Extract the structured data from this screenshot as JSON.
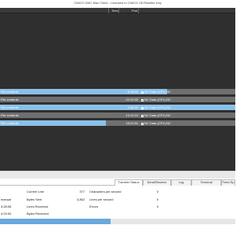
{
  "window": {
    "title": "CIMCO DNC-Max Client - Licensed to CIMCO V8 Reseller Key"
  },
  "queue": {
    "headers": [
      "Time",
      "Port"
    ],
    "rows": [
      {
        "label": "File contents",
        "time": "6:18:00",
        "source": "NC Data (CP1) NC",
        "progress": 0.71
      },
      {
        "label": "File contents",
        "time": "22:10:32",
        "source": "NC Data (CP1) NC",
        "progress": 0.0
      },
      {
        "label": "File contents",
        "time": "1:25:32",
        "source": "NC Data (CP1) NC",
        "progress": 1.0
      },
      {
        "label": "File contents",
        "time": "13:12:10",
        "source": "NC Data (CP1) NC",
        "progress": 0.0
      },
      {
        "label": "File contents",
        "time": "16:21:51",
        "source": "NC Data (CP1) NC",
        "progress": 0.45
      }
    ]
  },
  "tabs": [
    {
      "label": "Transfer Status",
      "active": true
    },
    {
      "label": "Send/Receive",
      "active": false
    },
    {
      "label": "Log",
      "active": false
    },
    {
      "label": "Terminal",
      "active": false
    },
    {
      "label": "Feed Sp",
      "active": false
    }
  ],
  "status": {
    "manual_label": "manual",
    "time1": "3:28:08",
    "time2": "4:23:53",
    "current_line_label": "Current Line",
    "current_line_value": "377",
    "bytes_sent_label": "Bytes Sent",
    "bytes_sent_value": "3,862",
    "lines_received_label": "Lines Received",
    "lines_received_value": "",
    "bytes_received_label": "Bytes Received",
    "bytes_received_value": "",
    "cps_label": "Characters per second",
    "cps_value": "0",
    "lps_label": "Lines per second",
    "lps_value": "0",
    "errors_label": "Errors",
    "errors_value": "0",
    "progress": 0.47
  }
}
